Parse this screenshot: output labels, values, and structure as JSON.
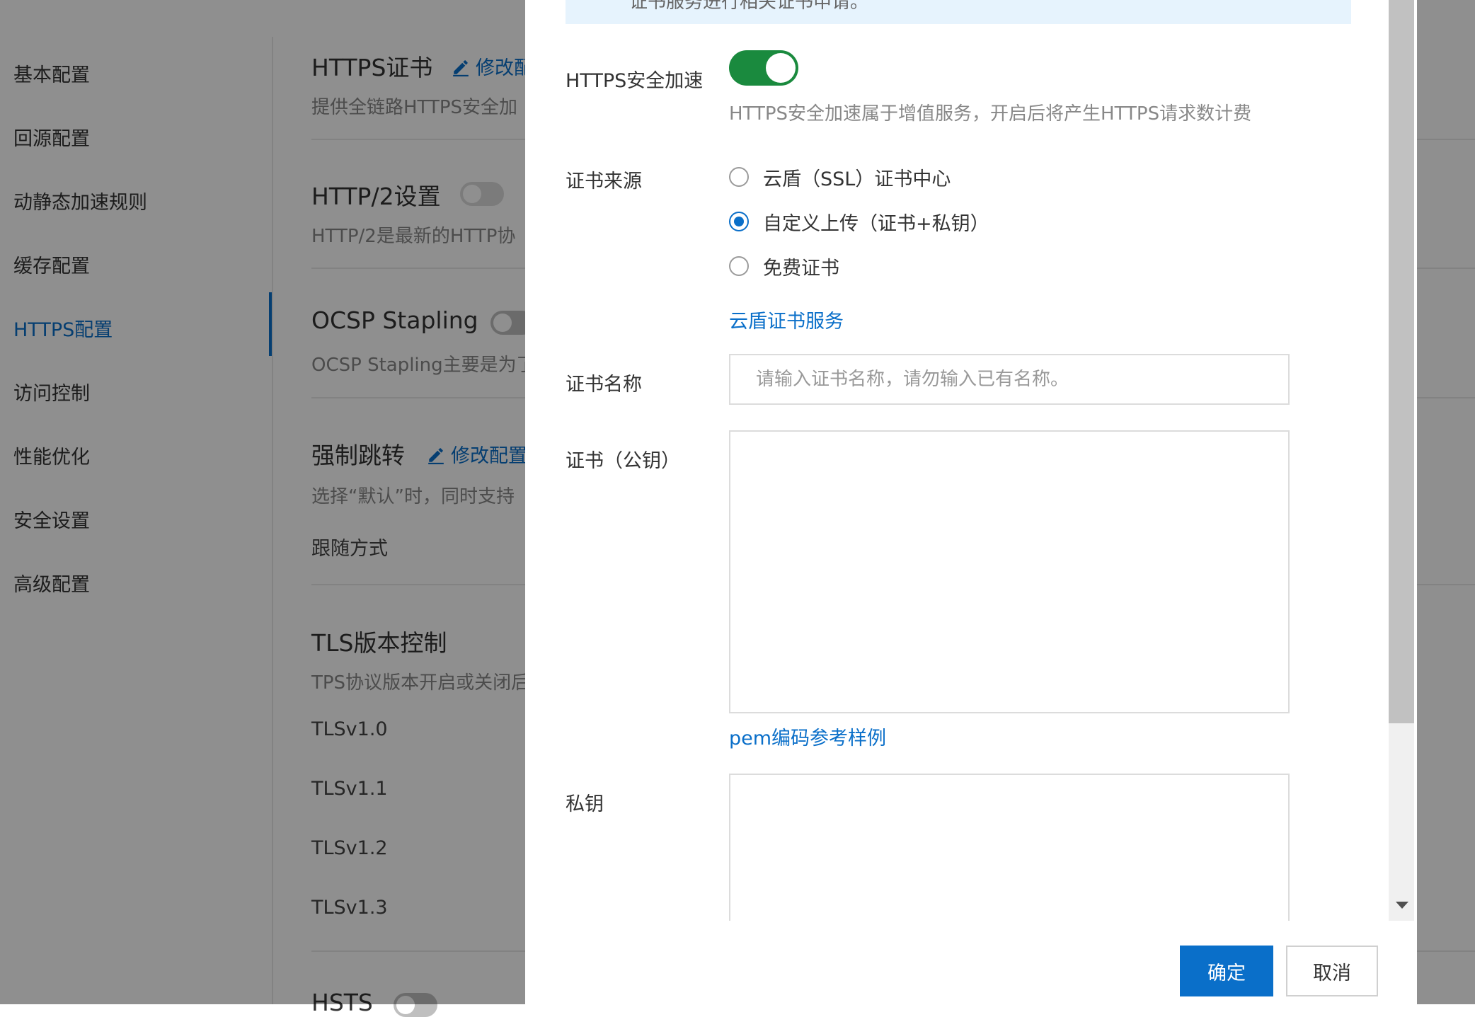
{
  "sidebar": {
    "items": [
      {
        "label": "基本配置"
      },
      {
        "label": "回源配置"
      },
      {
        "label": "动静态加速规则"
      },
      {
        "label": "缓存配置"
      },
      {
        "label": "HTTPS配置"
      },
      {
        "label": "访问控制"
      },
      {
        "label": "性能优化"
      },
      {
        "label": "安全设置"
      },
      {
        "label": "高级配置"
      }
    ],
    "active_index": 4
  },
  "background": {
    "sections": [
      {
        "title": "HTTPS证书",
        "desc": "提供全链路HTTPS安全加",
        "edit_label": "修改配"
      },
      {
        "title": "HTTP/2设置",
        "desc": "HTTP/2是最新的HTTP协"
      },
      {
        "title": "OCSP Stapling",
        "desc": "OCSP Stapling主要是为了"
      },
      {
        "title": "强制跳转",
        "desc": "选择“默认”时，同时支持",
        "edit_label": "修改配置",
        "value": "跟随方式"
      },
      {
        "title": "TLS版本控制",
        "desc": "TPS协议版本开启或关闭后"
      },
      {
        "title": "HSTS"
      }
    ],
    "tls_versions": [
      "TLSv1.0",
      "TLSv1.1",
      "TLSv1.2",
      "TLSv1.3"
    ]
  },
  "dialog": {
    "banner_text": "证书服务进行相关证书申请。",
    "https_accel": {
      "label": "HTTPS安全加速",
      "enabled": true,
      "help": "HTTPS安全加速属于增值服务，开启后将产生HTTPS请求数计费"
    },
    "cert_source": {
      "label": "证书来源",
      "options": [
        {
          "label": "云盾（SSL）证书中心",
          "checked": false
        },
        {
          "label": "自定义上传（证书+私钥）",
          "checked": true
        },
        {
          "label": "免费证书",
          "checked": false
        }
      ],
      "link": "云盾证书服务"
    },
    "cert_name": {
      "label": "证书名称",
      "placeholder": "请输入证书名称，请勿输入已有名称。",
      "value": ""
    },
    "public_key": {
      "label": "证书（公钥）",
      "value": "",
      "link": "pem编码参考样例"
    },
    "private_key": {
      "label": "私钥",
      "value": ""
    },
    "buttons": {
      "ok": "确定",
      "cancel": "取消"
    }
  },
  "colors": {
    "accent": "#0a6fc9",
    "toggle_on": "#1a8a3e",
    "overlay": "rgba(0,0,0,0.44)"
  }
}
